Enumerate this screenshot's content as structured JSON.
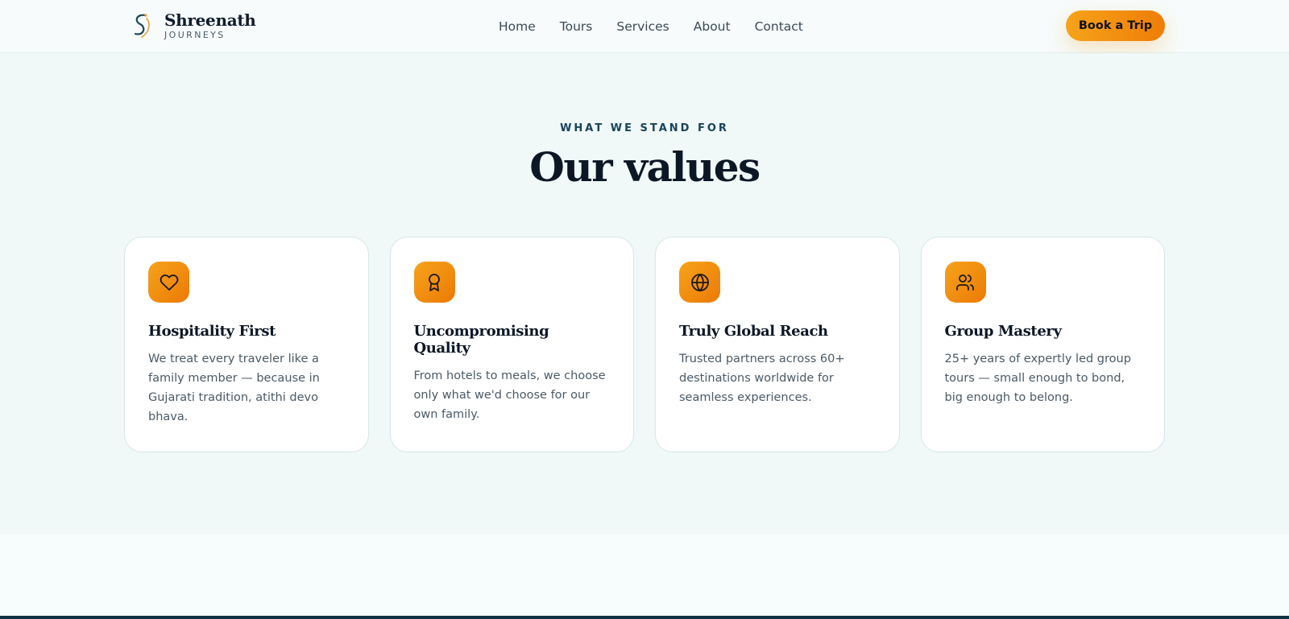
{
  "header": {
    "brand_name": "Shreenath",
    "brand_sub": "JOURNEYS",
    "nav": [
      "Home",
      "Tours",
      "Services",
      "About",
      "Contact"
    ],
    "cta_label": "Book a Trip"
  },
  "section": {
    "eyebrow": "WHAT WE STAND FOR",
    "title": "Our values",
    "cards": [
      {
        "icon": "heart-icon",
        "title": "Hospitality First",
        "text": "We treat every traveler like a family member — because in Gujarati tradition, atithi devo bhava."
      },
      {
        "icon": "award-icon",
        "title": "Uncompromising Quality",
        "text": "From hotels to meals, we choose only what we'd choose for our own family."
      },
      {
        "icon": "globe-icon",
        "title": "Truly Global Reach",
        "text": "Trusted partners across 60+ destinations worldwide for seamless experiences."
      },
      {
        "icon": "users-icon",
        "title": "Group Mastery",
        "text": "25+ years of expertly led group tours — small enough to bond, big enough to belong."
      }
    ]
  },
  "colors": {
    "accent_start": "#f6a31a",
    "accent_end": "#ee7d07",
    "section_bg": "#f0f8f8",
    "heading": "#0c1726",
    "eyebrow": "#17445a",
    "footer": "#0f3342"
  }
}
